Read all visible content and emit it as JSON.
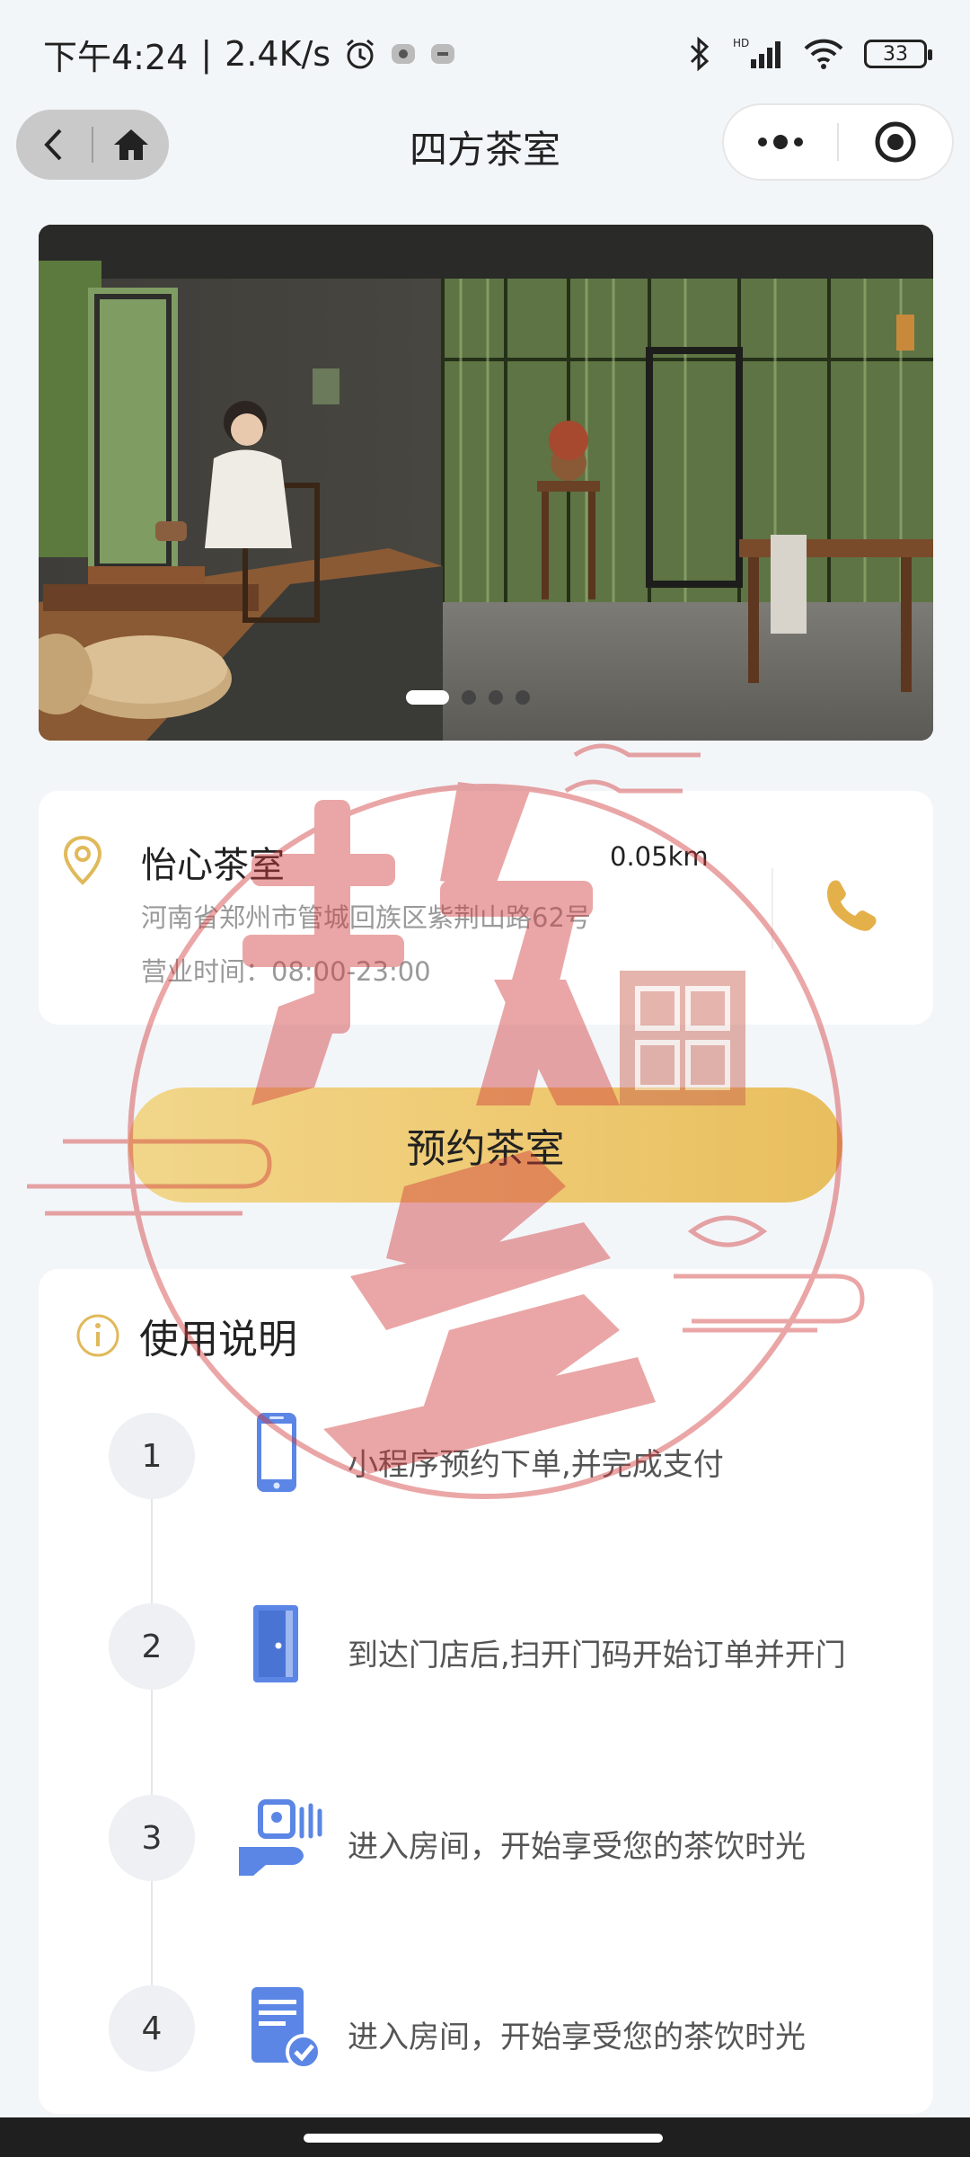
{
  "status_bar": {
    "time": "下午4:24",
    "speed": "2.4K/s",
    "battery": "33"
  },
  "nav": {
    "title": "四方茶室"
  },
  "banner": {
    "slide_count": 4,
    "active_slide": 1
  },
  "store": {
    "name": "怡心茶室",
    "distance": "0.05km",
    "address": "河南省郑州市管城回族区紫荆山路62号",
    "hours": "营业时间：08:00-23:00"
  },
  "reserve_button": {
    "label": "预约茶室"
  },
  "instructions": {
    "title": "使用说明",
    "steps": [
      {
        "num": "1",
        "icon": "phone-icon",
        "text": "小程序预约下单,并完成支付"
      },
      {
        "num": "2",
        "icon": "door-icon",
        "text": "到达门店后,扫开门码开始订单并开门"
      },
      {
        "num": "3",
        "icon": "tea-service-icon",
        "text": "进入房间，开始享受您的茶饮时光"
      },
      {
        "num": "4",
        "icon": "document-check-icon",
        "text": "进入房间，开始享受您的茶饮时光"
      }
    ]
  },
  "watermark": {
    "main": "软多",
    "seal": "信技息术"
  },
  "colors": {
    "accent_gold": "#e8be5e",
    "icon_blue": "#5b86e5",
    "watermark_red": "#d23c3c"
  }
}
